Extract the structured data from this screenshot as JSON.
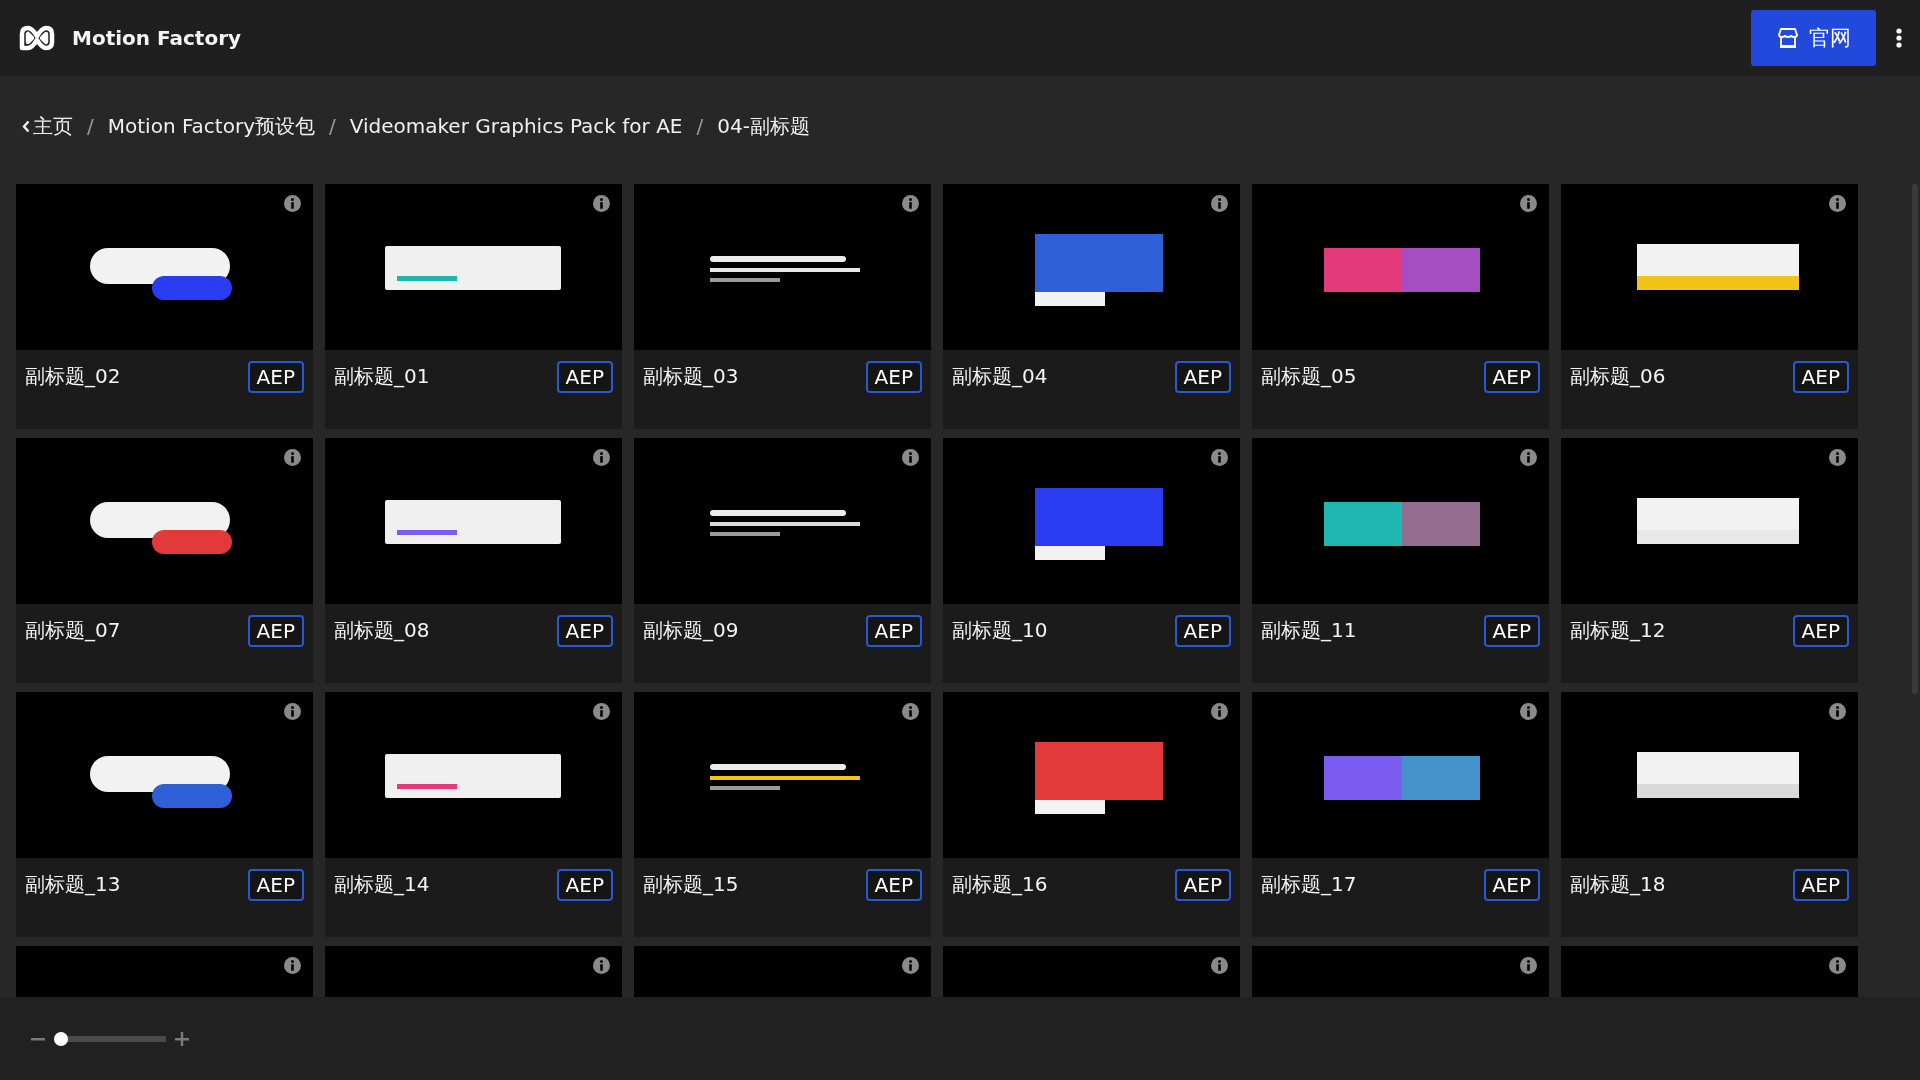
{
  "app": {
    "title": "Motion Factory"
  },
  "header_button": {
    "label": "官网"
  },
  "breadcrumb_separator": "/",
  "breadcrumb": [
    {
      "label": "主页",
      "kind": "back"
    },
    {
      "label": "Motion Factory预设包",
      "kind": "link"
    },
    {
      "label": "Videomaker Graphics Pack for AE",
      "kind": "link"
    },
    {
      "label": "04-副标题",
      "kind": "current"
    }
  ],
  "cards": [
    {
      "title": "副标题_02",
      "badge": "AEP"
    },
    {
      "title": "副标题_01",
      "badge": "AEP"
    },
    {
      "title": "副标题_03",
      "badge": "AEP"
    },
    {
      "title": "副标题_04",
      "badge": "AEP"
    },
    {
      "title": "副标题_05",
      "badge": "AEP"
    },
    {
      "title": "副标题_06",
      "badge": "AEP"
    },
    {
      "title": "副标题_07",
      "badge": "AEP"
    },
    {
      "title": "副标题_08",
      "badge": "AEP"
    },
    {
      "title": "副标题_09",
      "badge": "AEP"
    },
    {
      "title": "副标题_10",
      "badge": "AEP"
    },
    {
      "title": "副标题_11",
      "badge": "AEP"
    },
    {
      "title": "副标题_12",
      "badge": "AEP"
    },
    {
      "title": "副标题_13",
      "badge": "AEP"
    },
    {
      "title": "副标题_14",
      "badge": "AEP"
    },
    {
      "title": "副标题_15",
      "badge": "AEP"
    },
    {
      "title": "副标题_16",
      "badge": "AEP"
    },
    {
      "title": "副标题_17",
      "badge": "AEP"
    },
    {
      "title": "副标题_18",
      "badge": "AEP"
    },
    {
      "thumbnail": {
        "kind": "blank"
      }
    },
    {
      "thumbnail": {
        "kind": "blank"
      }
    },
    {
      "thumbnail": {
        "kind": "blank"
      }
    },
    {
      "thumbnail": {
        "kind": "blank"
      }
    },
    {
      "thumbnail": {
        "kind": "blank"
      }
    },
    {
      "thumbnail": {
        "kind": "blank"
      }
    }
  ],
  "zoom_slider": {
    "level": 0.0
  }
}
